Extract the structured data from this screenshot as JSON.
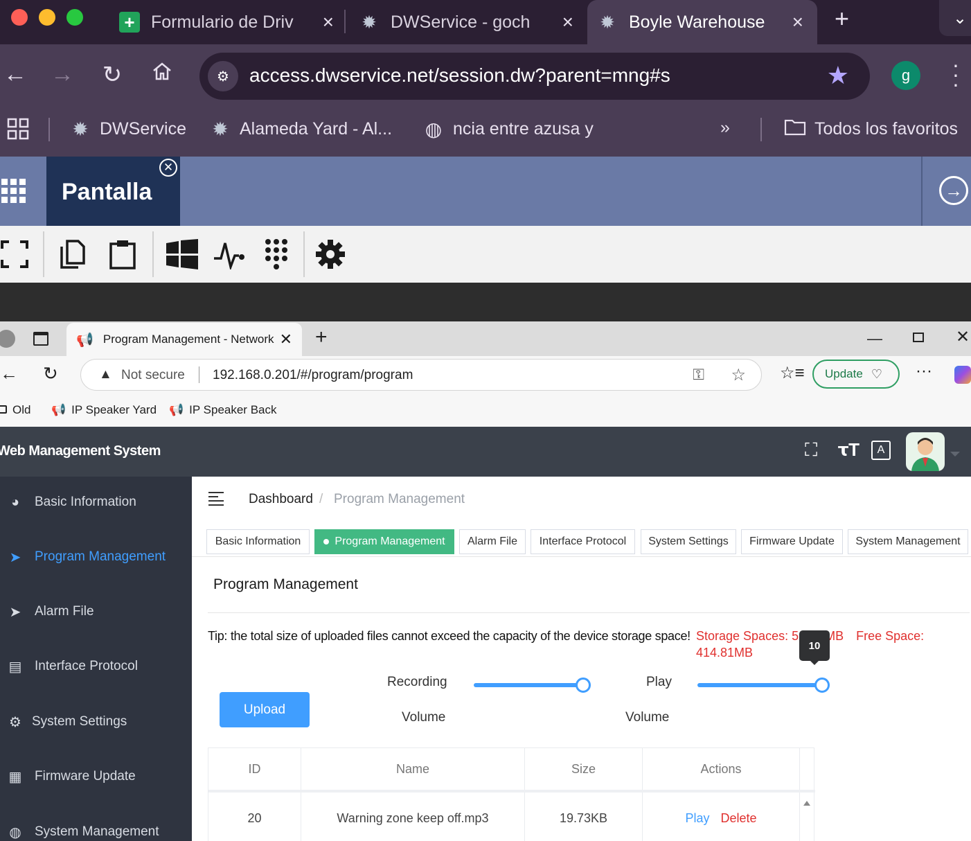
{
  "outer_browser": {
    "tabs": [
      {
        "title": "Formulario de Driv",
        "icon": "sheets-icon"
      },
      {
        "title": "DWService - goch",
        "icon": "gear-icon"
      },
      {
        "title": "Boyle Warehouse",
        "icon": "gear-icon",
        "active": true
      }
    ],
    "url": "access.dwservice.net/session.dw?parent=mng#s",
    "profile_initial": "g",
    "bookmarks": [
      {
        "label": "DWService",
        "icon": "gear-icon"
      },
      {
        "label": "Alameda Yard - Al...",
        "icon": "gear-icon"
      },
      {
        "label": "ncia entre azusa y",
        "icon": "globe-icon"
      }
    ],
    "all_bookmarks": "Todos los favoritos"
  },
  "dwservice": {
    "tab_label": "Pantalla",
    "toolbar_icons": [
      "fullscreen-icon",
      "copy-icon",
      "clipboard-icon",
      "windows-icon",
      "activity-icon",
      "keypad-icon",
      "settings-icon"
    ]
  },
  "inner_browser": {
    "tab_title": "Program Management - Network",
    "security": "Not secure",
    "url": "192.168.0.201/#/program/program",
    "update_label": "Update",
    "bookmarks": [
      "Old",
      "IP Speaker Yard",
      "IP Speaker Back"
    ]
  },
  "app": {
    "title": "Web Management System",
    "sidebar": [
      {
        "label": "Basic Information",
        "icon": "dashboard-icon"
      },
      {
        "label": "Program Management",
        "icon": "send-icon",
        "active": true
      },
      {
        "label": "Alarm File",
        "icon": "send-icon"
      },
      {
        "label": "Interface Protocol",
        "icon": "document-icon"
      },
      {
        "label": "System Settings",
        "icon": "gear-icon"
      },
      {
        "label": "Firmware Update",
        "icon": "grid-icon"
      },
      {
        "label": "System Management",
        "icon": "globe-icon"
      }
    ],
    "breadcrumb": {
      "home": "Dashboard",
      "separator": "/",
      "current": "Program Management"
    },
    "tags": [
      "Basic Information",
      "Program Management",
      "Alarm File",
      "Interface Protocol",
      "System Settings",
      "Firmware Update",
      "System Management"
    ],
    "page_title": "Program Management",
    "tip": "Tip: the total size of uploaded files cannot exceed the capacity of the device storage space!",
    "storage_label": "Storage Spaces: 5",
    "storage_tail": "MB",
    "free_label": "Free Space:",
    "free_value": "414.81MB",
    "recording_label": "Recording",
    "volume_label": "Volume",
    "play_label": "Play",
    "recording_volume": 0.88,
    "play_volume": 1.0,
    "tooltip_value": "10",
    "upload_label": "Upload",
    "table": {
      "headers": [
        "ID",
        "Name",
        "Size",
        "Actions"
      ],
      "rows": [
        {
          "id": "20",
          "name": "Warning zone keep off.mp3",
          "size": "19.73KB",
          "play": "Play",
          "delete": "Delete"
        }
      ]
    }
  },
  "colors": {
    "accent": "#409eff",
    "active_tag": "#42b983",
    "danger": "#e0302e"
  }
}
